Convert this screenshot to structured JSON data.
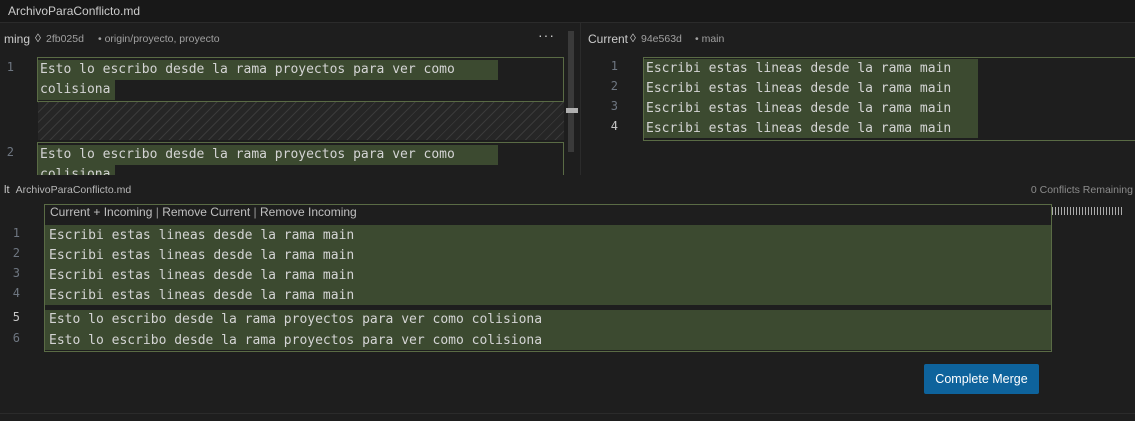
{
  "titlebar": {
    "file": "ArchivoParaConflicto.md"
  },
  "incoming": {
    "label": "ming",
    "commit_icon": "◊",
    "commit": "2fb025d",
    "branches": "• origin/proyecto, proyecto",
    "more": "···",
    "lines": [
      {
        "num": "1",
        "text": "Esto lo escribo desde la rama proyectos para ver como",
        "wrap": "colisiona"
      },
      {
        "num": "2",
        "text": "Esto lo escribo desde la rama proyectos para ver como",
        "wrap": "colisiona"
      }
    ]
  },
  "current": {
    "label": "Current",
    "commit_icon": "◊",
    "commit": "94e563d",
    "branches": "• main",
    "lines": [
      {
        "num": "1",
        "text": "Escribi estas lineas desde la rama main"
      },
      {
        "num": "2",
        "text": "Escribi estas lineas desde la rama main"
      },
      {
        "num": "3",
        "text": "Escribi estas lineas desde la rama main"
      },
      {
        "num": "4",
        "text": "Escribi estas lineas desde la rama main"
      }
    ]
  },
  "result": {
    "label": "lt",
    "file": "ArchivoParaConflicto.md",
    "conflicts": "0 Conflicts Remaining",
    "codelens": {
      "a": "Current + Incoming",
      "sep": " | ",
      "b": "Remove Current",
      "c": "Remove Incoming"
    },
    "lines": [
      {
        "num": "1",
        "text": "Escribi estas lineas desde la rama main"
      },
      {
        "num": "2",
        "text": "Escribi estas lineas desde la rama main"
      },
      {
        "num": "3",
        "text": "Escribi estas lineas desde la rama main"
      },
      {
        "num": "4",
        "text": "Escribi estas lineas desde la rama main"
      },
      {
        "num": "5",
        "text": "Esto lo escribo desde la rama proyectos para ver como colisiona"
      },
      {
        "num": "6",
        "text": "Esto lo escribo desde la rama proyectos para ver como colisiona"
      }
    ]
  },
  "actions": {
    "complete_merge": "Complete Merge"
  }
}
